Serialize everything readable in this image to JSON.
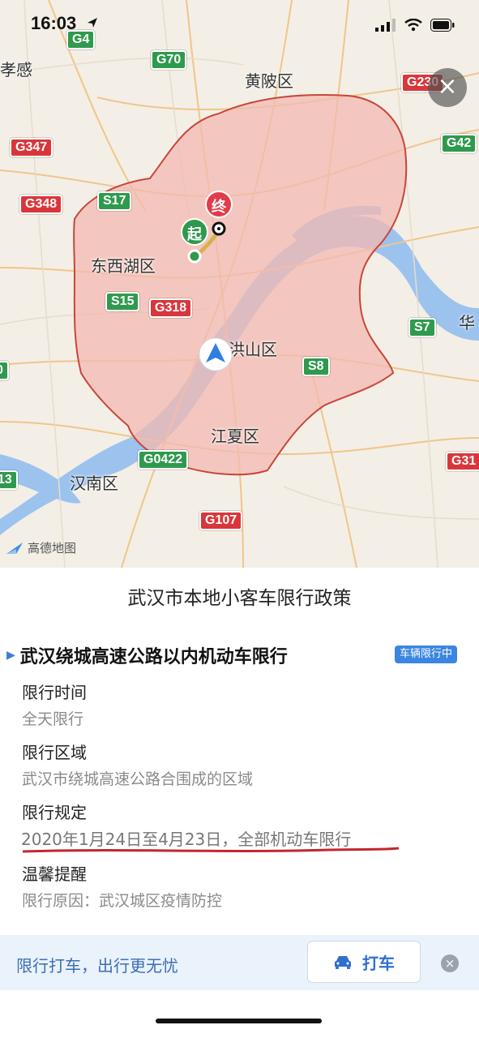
{
  "status_bar": {
    "time": "16:03"
  },
  "map": {
    "roads": [
      {
        "id": "G4",
        "color": "green"
      },
      {
        "id": "G70",
        "color": "green"
      },
      {
        "id": "G230",
        "color": "red"
      },
      {
        "id": "G347",
        "color": "red"
      },
      {
        "id": "G42",
        "color": "green"
      },
      {
        "id": "G348",
        "color": "red"
      },
      {
        "id": "S17",
        "color": "green"
      },
      {
        "id": "S15",
        "color": "green"
      },
      {
        "id": "G318",
        "color": "red"
      },
      {
        "id": "S7",
        "color": "green"
      },
      {
        "id": "S8",
        "color": "green"
      },
      {
        "id": "G0422",
        "color": "green"
      },
      {
        "id": "G31",
        "color": "red"
      },
      {
        "id": "G107",
        "color": "red"
      },
      {
        "id": "13",
        "color": "green"
      },
      {
        "id": "0",
        "color": "green"
      }
    ],
    "places": {
      "xiaogan": "孝感",
      "huangpi": "黄陂区",
      "dongxihu": "东西湖区",
      "hongshan": "洪山区",
      "jiangxia": "江夏区",
      "hannan": "汉南区",
      "hua": "华"
    },
    "markers": {
      "start": "起",
      "end": "终"
    },
    "logo_text": "高德地图",
    "colors": {
      "zone_fill": "#f3b9b1",
      "zone_stroke": "#c9463a",
      "river": "#9cc3ee",
      "location": "#2f7fe0"
    }
  },
  "panel": {
    "title": "武汉市本地小客车限行政策",
    "policy_heading": "武汉绕城高速公路以内机动车限行",
    "status_badge": "车辆限行中",
    "sections": [
      {
        "label": "限行时间",
        "value": "全天限行"
      },
      {
        "label": "限行区域",
        "value": "武汉市绕城高速公路合围成的区域"
      },
      {
        "label": "限行规定",
        "value": "2020年1月24日至4月23日，全部机动车限行"
      },
      {
        "label": "温馨提醒",
        "value": "限行原因：武汉城区疫情防控"
      }
    ]
  },
  "bottom_bar": {
    "promo_text": "限行打车，出行更无忧",
    "taxi_button": "打车"
  }
}
